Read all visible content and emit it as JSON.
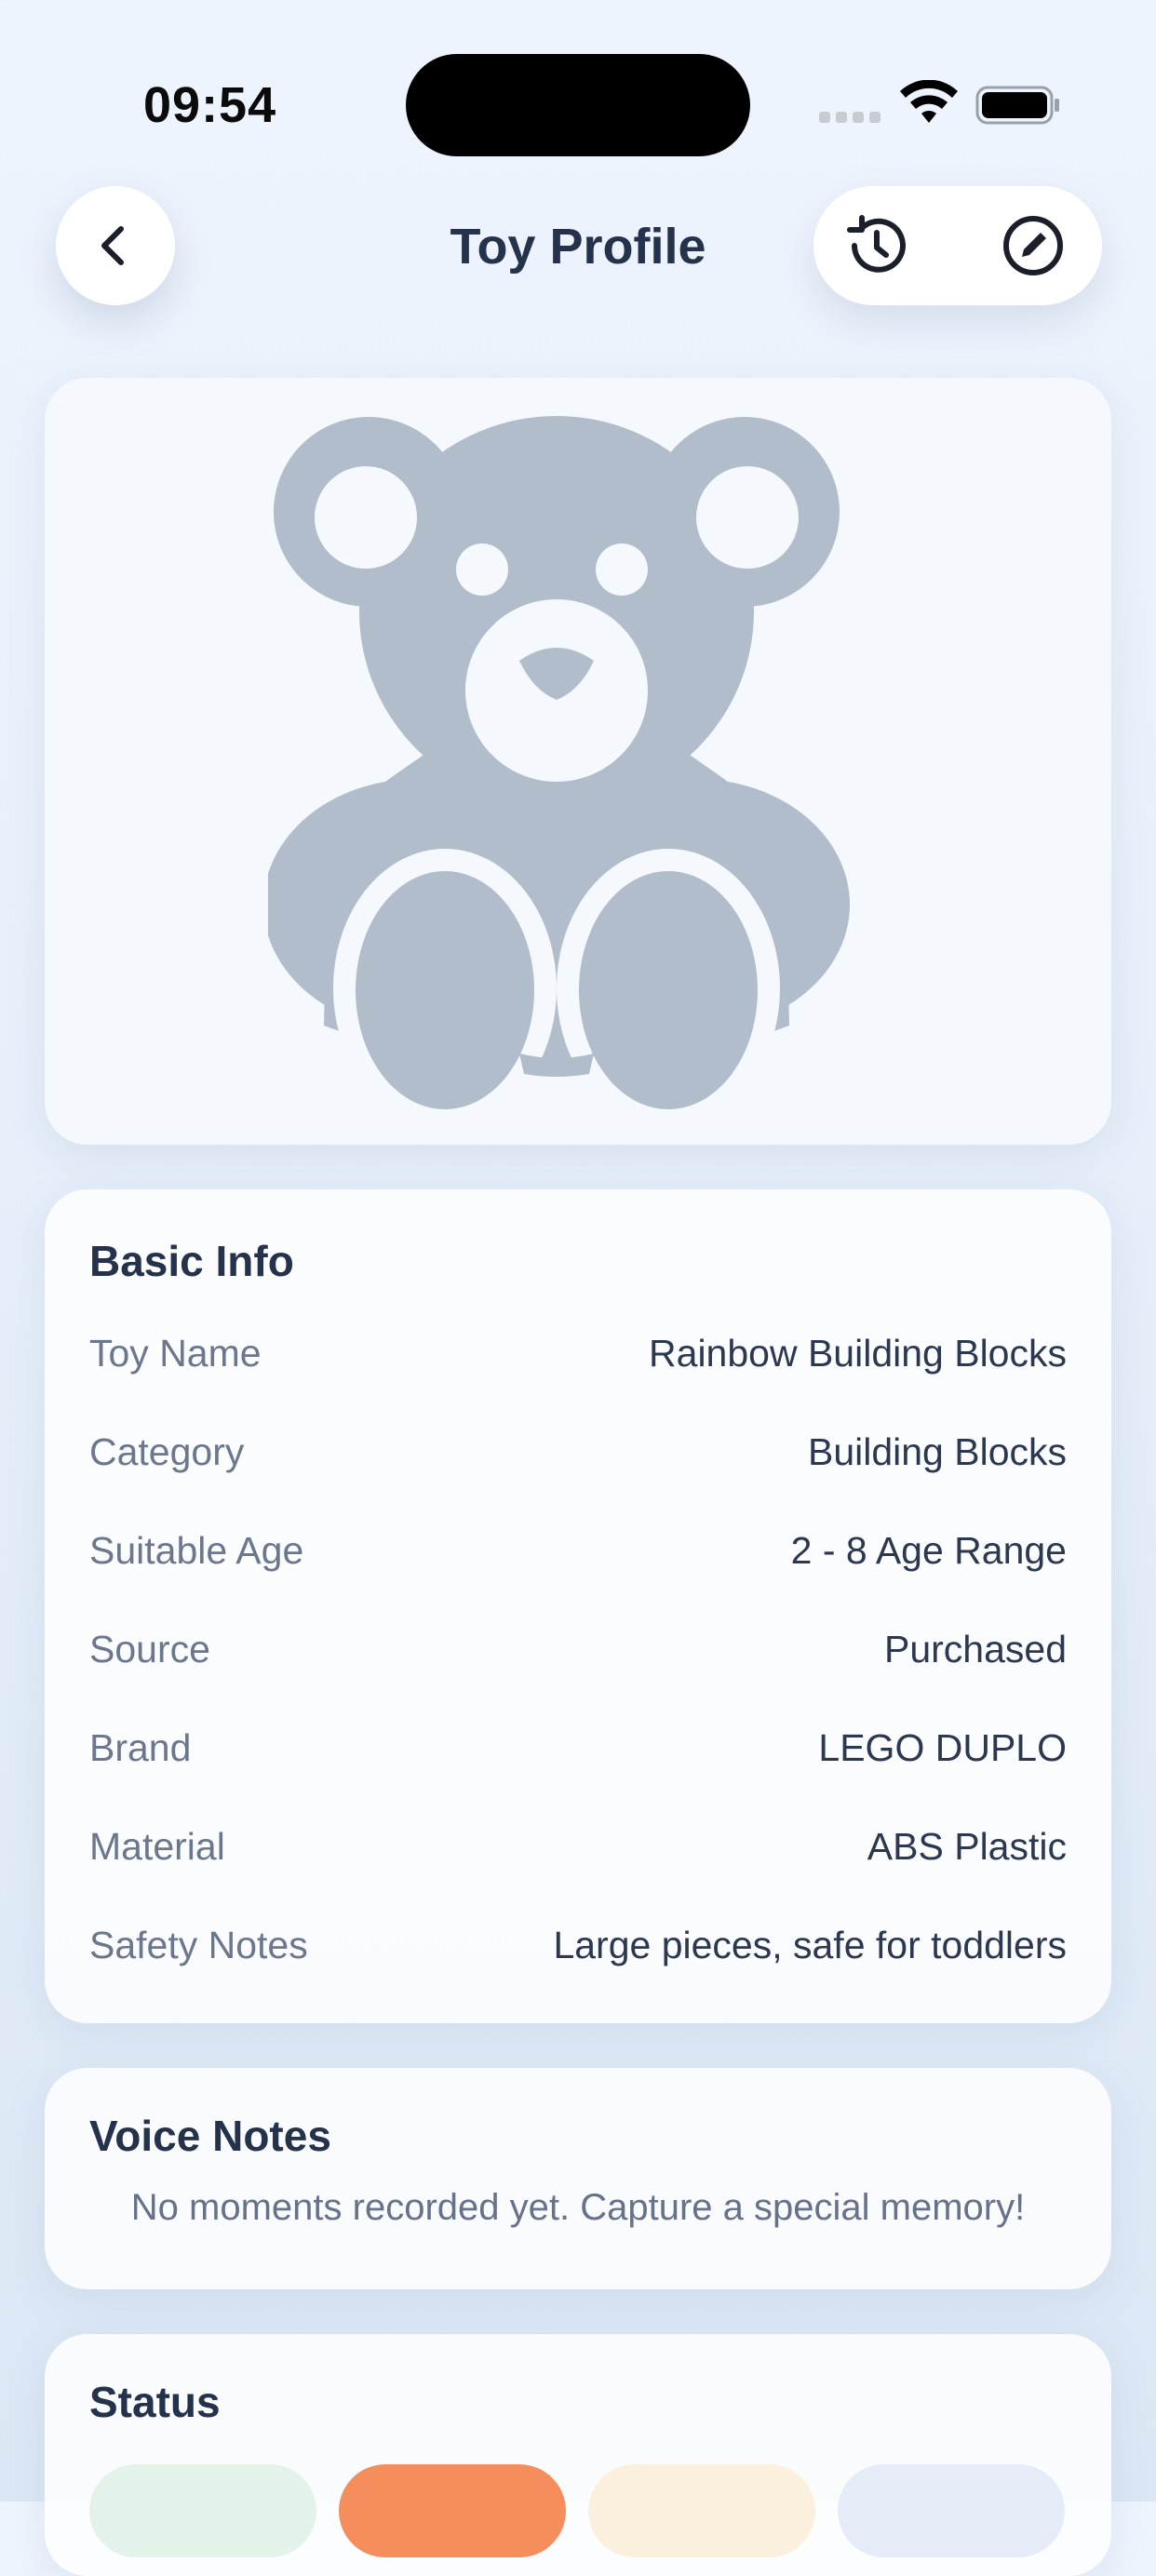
{
  "status_bar": {
    "time": "09:54"
  },
  "nav": {
    "title": "Toy Profile",
    "back_icon": "chevron-left-icon",
    "history_icon": "history-icon",
    "edit_icon": "edit-circle-icon"
  },
  "hero": {
    "image_icon": "teddy-bear-icon",
    "color": "#b2bdcb"
  },
  "basic_info": {
    "title": "Basic Info",
    "rows": [
      {
        "label": "Toy Name",
        "value": "Rainbow Building Blocks"
      },
      {
        "label": "Category",
        "value": "Building Blocks"
      },
      {
        "label": "Suitable Age",
        "value": "2 - 8 Age Range"
      },
      {
        "label": "Source",
        "value": "Purchased"
      },
      {
        "label": "Brand",
        "value": "LEGO DUPLO"
      },
      {
        "label": "Material",
        "value": "ABS Plastic"
      },
      {
        "label": "Safety Notes",
        "value": "Large pieces, safe for toddlers"
      }
    ]
  },
  "voice_notes": {
    "title": "Voice Notes",
    "empty_text": "No moments recorded yet. Capture a special memory!"
  },
  "status": {
    "title": "Status",
    "chips": [
      {
        "label": "",
        "bg": "#e3f3ea",
        "fg": "#7cc79d"
      },
      {
        "label": "",
        "bg": "#f58e5c",
        "fg": "#ffffff"
      },
      {
        "label": "",
        "bg": "#fbf0dd",
        "fg": "#e8b86a"
      },
      {
        "label": "",
        "bg": "#e6ecf7",
        "fg": "#93a6c8"
      }
    ]
  }
}
